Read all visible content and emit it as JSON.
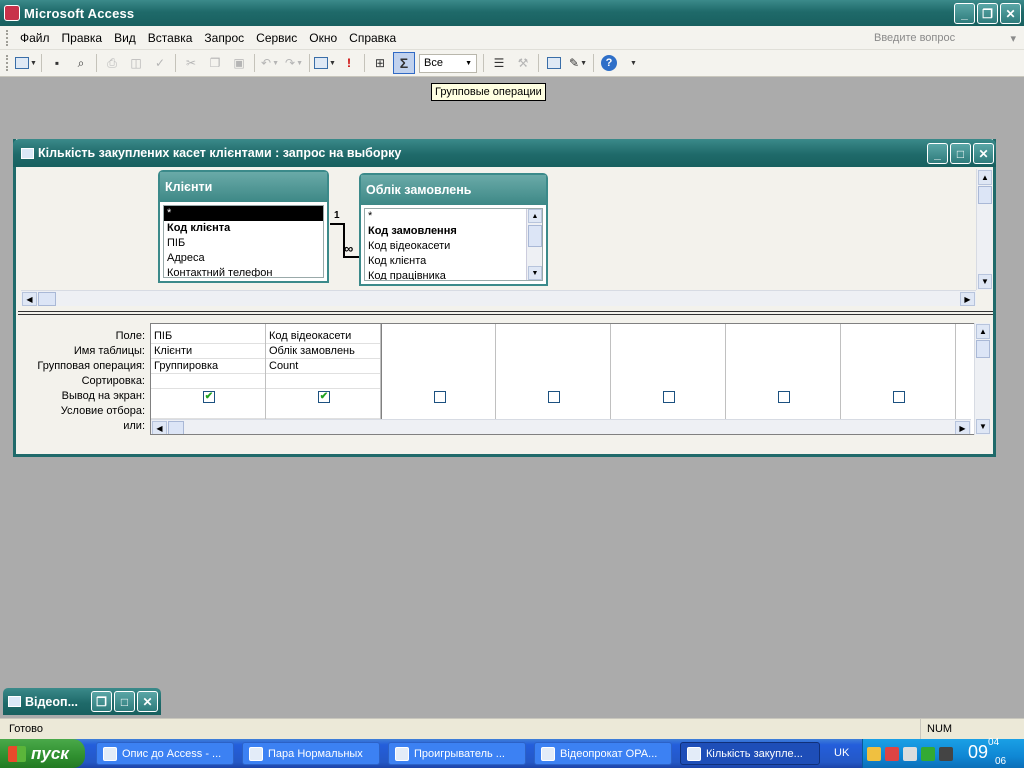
{
  "app": {
    "title": "Microsoft Access"
  },
  "window_buttons": {
    "minimize": "_",
    "restore": "❐",
    "close": "✕"
  },
  "menu": {
    "items": [
      "Файл",
      "Правка",
      "Вид",
      "Вставка",
      "Запрос",
      "Сервис",
      "Окно",
      "Справка"
    ],
    "ask_placeholder": "Введите вопрос"
  },
  "toolbar": {
    "sigma_label": "Σ",
    "top_values_value": "Все",
    "run_label": "!",
    "help_label": "?",
    "tooltip": "Групповые операции"
  },
  "query_window": {
    "title": "Кількість закуплених касет клієнтами : запрос на выборку",
    "tables": [
      {
        "name": "Клієнти",
        "fields": [
          "*",
          "Код клієнта",
          "ПІБ",
          "Адреса",
          "Контактний телефон"
        ]
      },
      {
        "name": "Облік замовлень",
        "fields": [
          "*",
          "Код замовлення",
          "Код відеокасети",
          "Код клієнта",
          "Код працівника"
        ]
      }
    ],
    "relationship": {
      "one": "1",
      "many": "∞"
    },
    "grid_row_labels": [
      "Поле:",
      "Имя таблицы:",
      "Групповая операция:",
      "Сортировка:",
      "Вывод на экран:",
      "Условие отбора:",
      "или:"
    ],
    "grid_columns": [
      {
        "field": "ПІБ",
        "table": "Клієнти",
        "total": "Группировка",
        "sort": "",
        "show": true
      },
      {
        "field": "Код відеокасети",
        "table": "Облік замовлень",
        "total": "Count",
        "sort": "",
        "show": true
      },
      {
        "field": "",
        "table": "",
        "total": "",
        "sort": "",
        "show": false
      },
      {
        "field": "",
        "table": "",
        "total": "",
        "sort": "",
        "show": false
      },
      {
        "field": "",
        "table": "",
        "total": "",
        "sort": "",
        "show": false
      },
      {
        "field": "",
        "table": "",
        "total": "",
        "sort": "",
        "show": false
      },
      {
        "field": "",
        "table": "",
        "total": "",
        "sort": "",
        "show": false
      }
    ]
  },
  "minimized_window": {
    "title": "Відеоп..."
  },
  "status": {
    "text": "Готово",
    "num": "NUM"
  },
  "taskbar": {
    "start_label": "пуск",
    "tasks": [
      "Опис до Access - ...",
      "Пара Нормальных",
      "Проигрыватель ...",
      "Відеопрокат ОРА...",
      "Кількість закупле..."
    ],
    "language": "UK",
    "clock_hour": "09",
    "clock_minute": "04",
    "clock_second": "06"
  },
  "colors": {
    "titlebar": "#1f6a6a",
    "workspace": "#ababab",
    "taskbar": "#245edb",
    "start": "#2f8f2f"
  }
}
